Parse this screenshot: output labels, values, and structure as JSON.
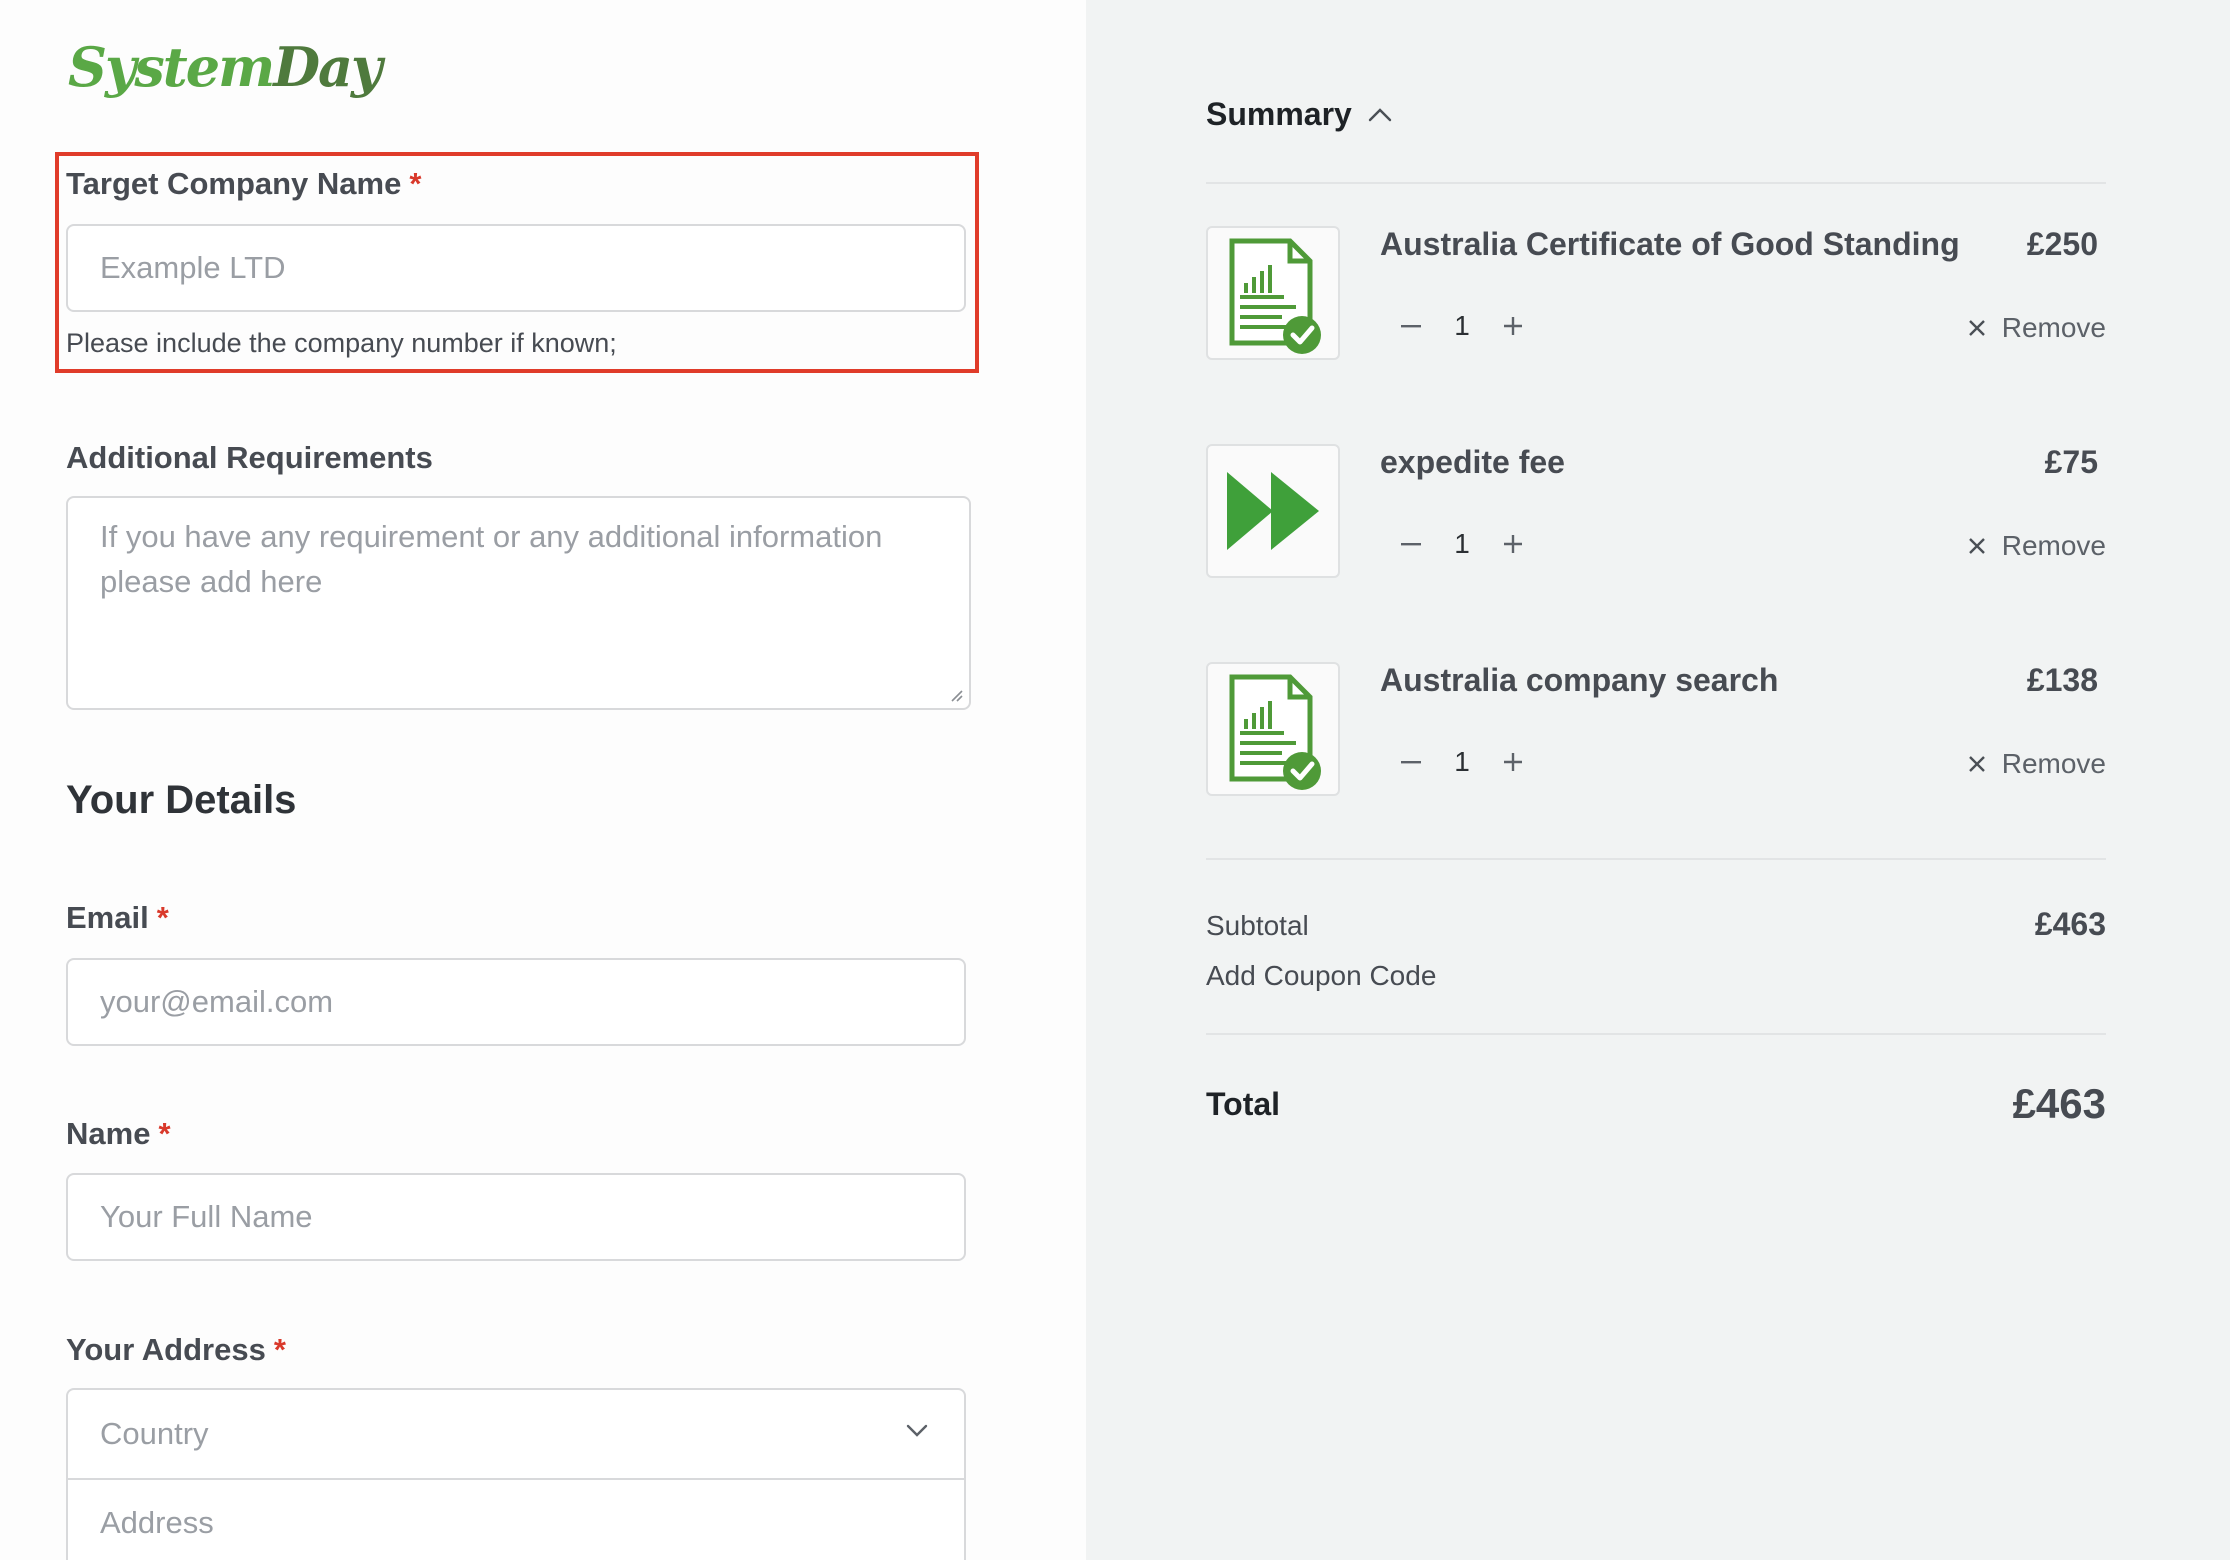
{
  "brand": {
    "logo_part1": "System",
    "logo_part2": "Day",
    "accent": "#5aa846"
  },
  "form": {
    "target_company": {
      "label": "Target Company Name",
      "required_mark": "*",
      "placeholder": "Example LTD",
      "help": "Please include the company number if known;"
    },
    "additional": {
      "label": "Additional Requirements",
      "placeholder": "If you have any requirement or any additional information please add here"
    },
    "details_title": "Your Details",
    "email": {
      "label": "Email",
      "required_mark": "*",
      "placeholder": "your@email.com"
    },
    "name": {
      "label": "Name",
      "required_mark": "*",
      "placeholder": "Your Full Name"
    },
    "address": {
      "label": "Your Address",
      "required_mark": "*",
      "country_placeholder": "Country",
      "address_placeholder": "Address"
    }
  },
  "summary": {
    "title": "Summary",
    "items": [
      {
        "name": "Australia Certificate of Good Standing",
        "price": "£250",
        "qty": "1",
        "remove": "Remove",
        "icon": "certificate-icon"
      },
      {
        "name": "expedite fee",
        "price": "£75",
        "qty": "1",
        "remove": "Remove",
        "icon": "fast-forward-icon"
      },
      {
        "name": "Australia company search",
        "price": "£138",
        "qty": "1",
        "remove": "Remove",
        "icon": "certificate-icon"
      }
    ],
    "subtotal_label": "Subtotal",
    "subtotal_value": "£463",
    "coupon_label": "Add Coupon Code",
    "total_label": "Total",
    "total_value": "£463"
  },
  "colors": {
    "required": "#d9392b",
    "highlight": "#e03c2a",
    "panel_bg": "#f1f3f3"
  }
}
